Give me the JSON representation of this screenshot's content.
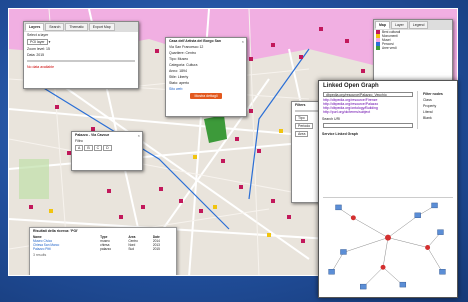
{
  "colors": {
    "map_bg": "#e9e4dc",
    "district": "#f2a6e3",
    "poi": "#c2185b",
    "poi_yellow": "#f1c40f",
    "route": "#2b6fd6",
    "park": "#bfe0a8",
    "accent": "#e3591e"
  },
  "top_panel": {
    "tabs": [
      "Layers",
      "Search",
      "Thematic",
      "Export Map"
    ],
    "dropdown_label": "Select a layer",
    "dropdown_value": "POI layer",
    "row1": "Zoom level: 15",
    "row2": "Data: 2015",
    "warning": "No data available"
  },
  "popup": {
    "title": "Casa dell'Artista del Borgo San",
    "lines": [
      "Via San Francesco 12",
      "Quartiere: Centro",
      "Tipo: Museo",
      "Categoria: Cultura",
      "Anno: 1894",
      "Stile: Liberty",
      "Stato: aperto",
      "Sito web"
    ],
    "button": "Mostra dettagli"
  },
  "small_popup": {
    "title": "Palazzo - Via Cavour",
    "label": "Filtro",
    "values": [
      "A",
      "B",
      "C",
      "D"
    ]
  },
  "mid_panel": {
    "title": "Filters",
    "rows": [
      "Tipo",
      "Periodo",
      "Area"
    ]
  },
  "right_sidebar": {
    "tabs": [
      "Map",
      "Layer",
      "Legend"
    ],
    "legend": [
      "Beni culturali",
      "Monumenti",
      "Musei",
      "Percorsi",
      "Aree verdi"
    ]
  },
  "lod": {
    "title": "Linked Open Graph",
    "search_value": "dbpedia.org/resource/Palazzo_Vecchio",
    "links": [
      "http://dbpedia.org/resource/Firenze",
      "http://dbpedia.org/resource/Palazzo",
      "http://dbpedia.org/ontology/Building",
      "http://purl.org/dc/terms/subject"
    ],
    "side_title": "Filter nodes",
    "side_items": [
      "Class",
      "Property",
      "Literal",
      "Blank"
    ],
    "filter_label": "Search URI",
    "graph_title": "Service Linked Graph"
  },
  "bottom_panel": {
    "title": "Risultati della ricerca: 'POI'",
    "headers": [
      "Name",
      "Type",
      "Area",
      "Date"
    ],
    "rows": [
      [
        "Museo Civico",
        "museo",
        "Centro",
        "2014"
      ],
      [
        "Chiesa San Marco",
        "chiesa",
        "Nord",
        "2013"
      ],
      [
        "Palazzo Pitti",
        "palazzo",
        "Sud",
        "2015"
      ]
    ],
    "footer": "3 results"
  }
}
